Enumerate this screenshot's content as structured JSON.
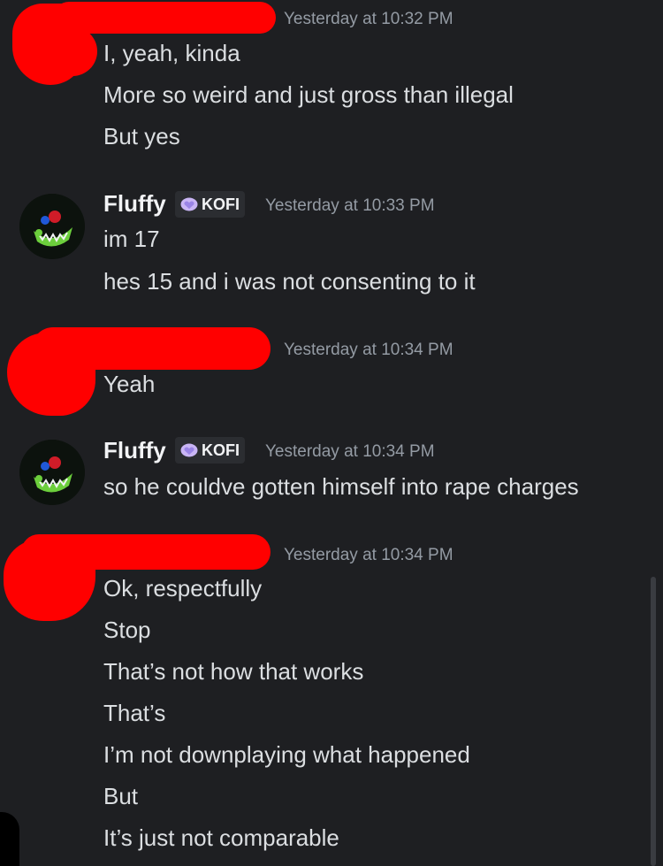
{
  "messages": [
    {
      "author_redacted": true,
      "timestamp": "Yesterday at 10:32 PM",
      "lines": [
        "I, yeah, kinda",
        "More so weird and just gross than illegal",
        "But yes"
      ]
    },
    {
      "author": "Fluffy",
      "badge": "KOFI",
      "timestamp": "Yesterday at 10:33 PM",
      "lines": [
        "im 17",
        "hes 15 and i was not consenting to it"
      ]
    },
    {
      "author_redacted": true,
      "timestamp": "Yesterday at 10:34 PM",
      "lines": [
        "Yeah"
      ]
    },
    {
      "author": "Fluffy",
      "badge": "KOFI",
      "timestamp": "Yesterday at 10:34 PM",
      "lines": [
        "so he couldve gotten himself into rape charges"
      ]
    },
    {
      "author_redacted": true,
      "timestamp": "Yesterday at 10:34 PM",
      "lines": [
        "Ok, respectfully",
        "Stop",
        "That’s not how that works",
        "That’s",
        "I’m not downplaying what happened",
        "But",
        "It’s just not comparable"
      ]
    }
  ],
  "colors": {
    "background": "#1e1f22",
    "text": "#dbdee1",
    "timestamp": "#949ba4",
    "redaction": "#ff0000",
    "badge_heart": "#c9b5f5"
  },
  "icons": {
    "badge": "heart-icon",
    "avatar": "fluffy-avatar-icon"
  }
}
